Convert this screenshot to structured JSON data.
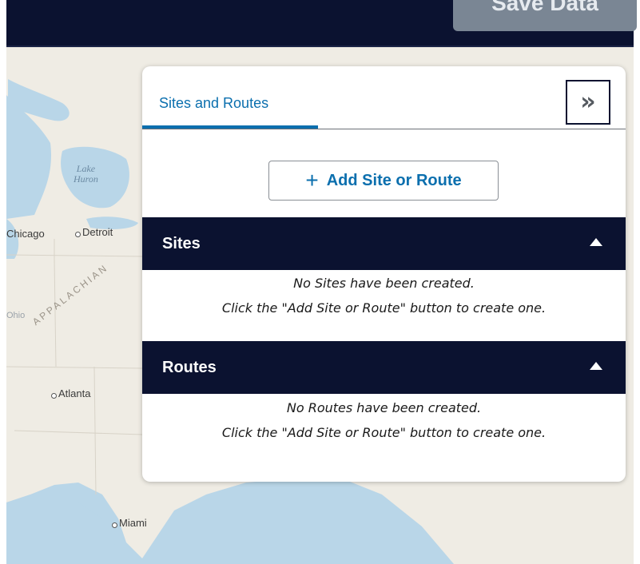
{
  "header": {
    "save_button_label": "Save Data"
  },
  "map": {
    "cities": [
      "Chicago",
      "Detroit",
      "Atlanta",
      "Miami"
    ],
    "lake_label_line1": "Lake",
    "lake_label_line2": "Huron",
    "region_label": "APPALACHIAN",
    "state_label": "Ohio"
  },
  "panel": {
    "tab_label": "Sites and Routes",
    "collapse_icon": "double-chevron-right-icon",
    "add_button_label": "Add Site or Route",
    "sections": [
      {
        "title": "Sites",
        "empty_line1": "No Sites have been created.",
        "empty_line2": "Click the \"Add Site or Route\" button to create one."
      },
      {
        "title": "Routes",
        "empty_line1": "No Routes have been created.",
        "empty_line2": "Click the \"Add Site or Route\" button to create one."
      }
    ]
  },
  "colors": {
    "header_bg": "#0b1230",
    "accent_blue": "#0b6fae",
    "section_bg": "#0b1230",
    "map_water": "#b9d6e8",
    "map_land": "#efece4"
  }
}
